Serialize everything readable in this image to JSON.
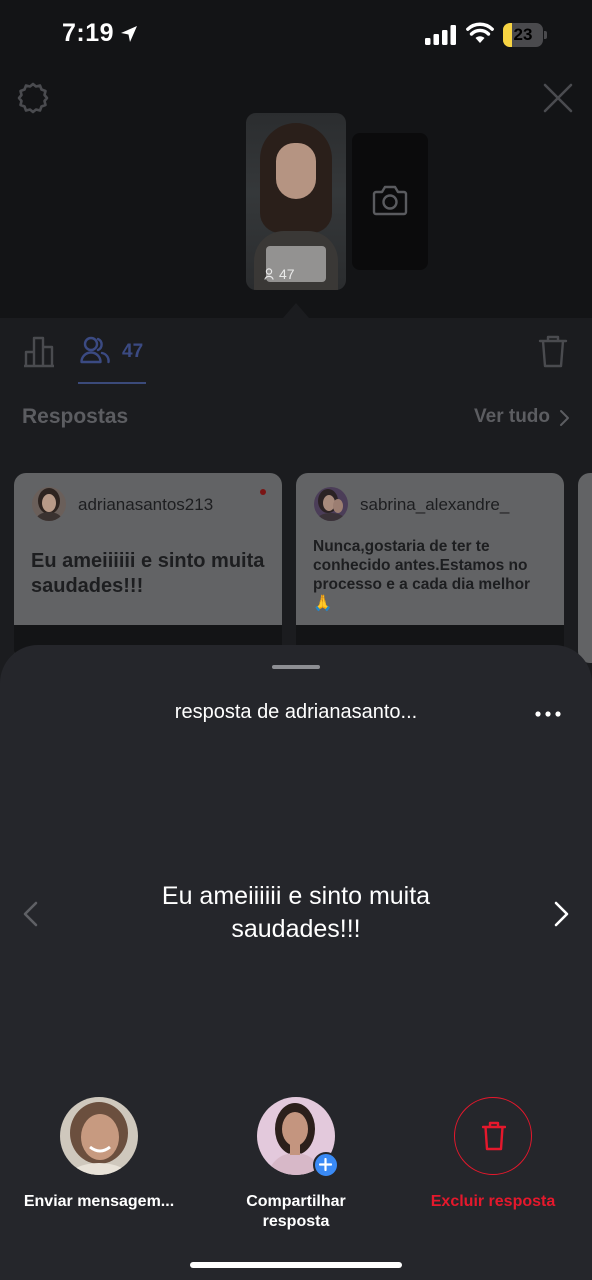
{
  "status_bar": {
    "time": "7:19",
    "battery_level": "23",
    "battery_fraction": 0.23,
    "battery_color": "#f7d442"
  },
  "story": {
    "viewer_count_overlay": "47"
  },
  "tabs": {
    "viewers_count": "47",
    "active_tab_color": "#3b4a82"
  },
  "replies_section": {
    "title": "Respostas",
    "see_all": "Ver tudo",
    "cards": [
      {
        "username": "adrianasantos213",
        "text": "Eu ameiiiiii e sinto muita saudades!!!",
        "unread": true
      },
      {
        "username": "sabrina_alexandre_",
        "text": "Nunca,gostaria de ter te conhecido antes.Estamos no processo e a cada dia melhor 🙏",
        "unread": false
      }
    ]
  },
  "sheet": {
    "title": "resposta de adrianasanto...",
    "reply_text": "Eu ameiiiiii e sinto muita saudades!!!",
    "actions": {
      "send_label": "Enviar mensagem...",
      "share_label": "Compartilhar resposta",
      "delete_label": "Excluir resposta",
      "delete_color": "#e5182c"
    }
  },
  "icons": [
    "location-arrow-icon",
    "signal-icon",
    "wifi-icon",
    "battery-icon",
    "gear-icon",
    "close-icon",
    "camera-icon",
    "bar-chart-icon",
    "viewers-icon",
    "trash-icon",
    "chevron-right-icon",
    "more-icon",
    "chevron-left-icon",
    "plus-icon"
  ]
}
